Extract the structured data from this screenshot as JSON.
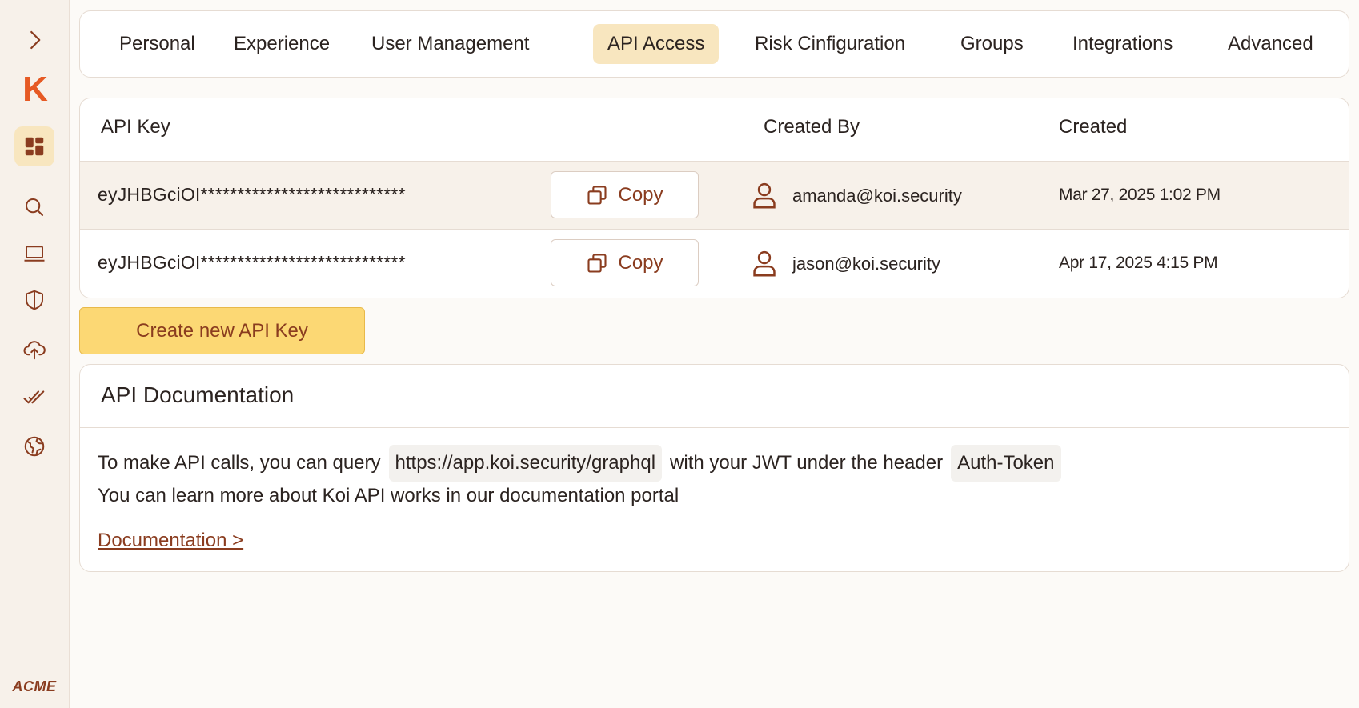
{
  "sidebar": {
    "expand_icon": "chevron-right-icon",
    "logo": "K",
    "brand": "ACME",
    "items": [
      {
        "name": "dashboard",
        "icon": "dashboard-icon",
        "active": true
      },
      {
        "name": "search",
        "icon": "search-icon"
      },
      {
        "name": "devices",
        "icon": "laptop-icon"
      },
      {
        "name": "security",
        "icon": "shield-icon"
      },
      {
        "name": "upload",
        "icon": "cloud-upload-icon"
      },
      {
        "name": "approvals",
        "icon": "double-check-icon"
      },
      {
        "name": "globe",
        "icon": "globe-icon"
      }
    ]
  },
  "tabs": [
    {
      "label": "Personal"
    },
    {
      "label": "Experience"
    },
    {
      "label": "User Management"
    },
    {
      "label": "API Access",
      "active": true
    },
    {
      "label": "Risk Cinfiguration"
    },
    {
      "label": "Groups"
    },
    {
      "label": "Integrations"
    },
    {
      "label": "Advanced"
    }
  ],
  "keys_table": {
    "headers": {
      "api_key": "API Key",
      "created_by": "Created By",
      "created": "Created"
    },
    "copy_label": "Copy",
    "rows": [
      {
        "key": "eyJHBGciOI****************************",
        "created_by": "amanda@koi.security",
        "created": "Mar 27, 2025 1:02 PM"
      },
      {
        "key": "eyJHBGciOI****************************",
        "created_by": "jason@koi.security",
        "created": "Apr 17, 2025 4:15 PM"
      }
    ]
  },
  "create_button": "Create new API Key",
  "docs": {
    "title": "API Documentation",
    "line1_prefix": "To make API calls, you can query",
    "endpoint": "https://app.koi.security/graphql",
    "line1_middle": "with your JWT under the header",
    "header_name": "Auth-Token",
    "line2": "You can learn more about Koi API works in our documentation portal",
    "link": "Documentation >"
  },
  "colors": {
    "accent": "#8a3c1f",
    "brand_orange": "#e65a24",
    "active_tab_bg": "#f8e6bf",
    "primary_button": "#fcd874"
  }
}
